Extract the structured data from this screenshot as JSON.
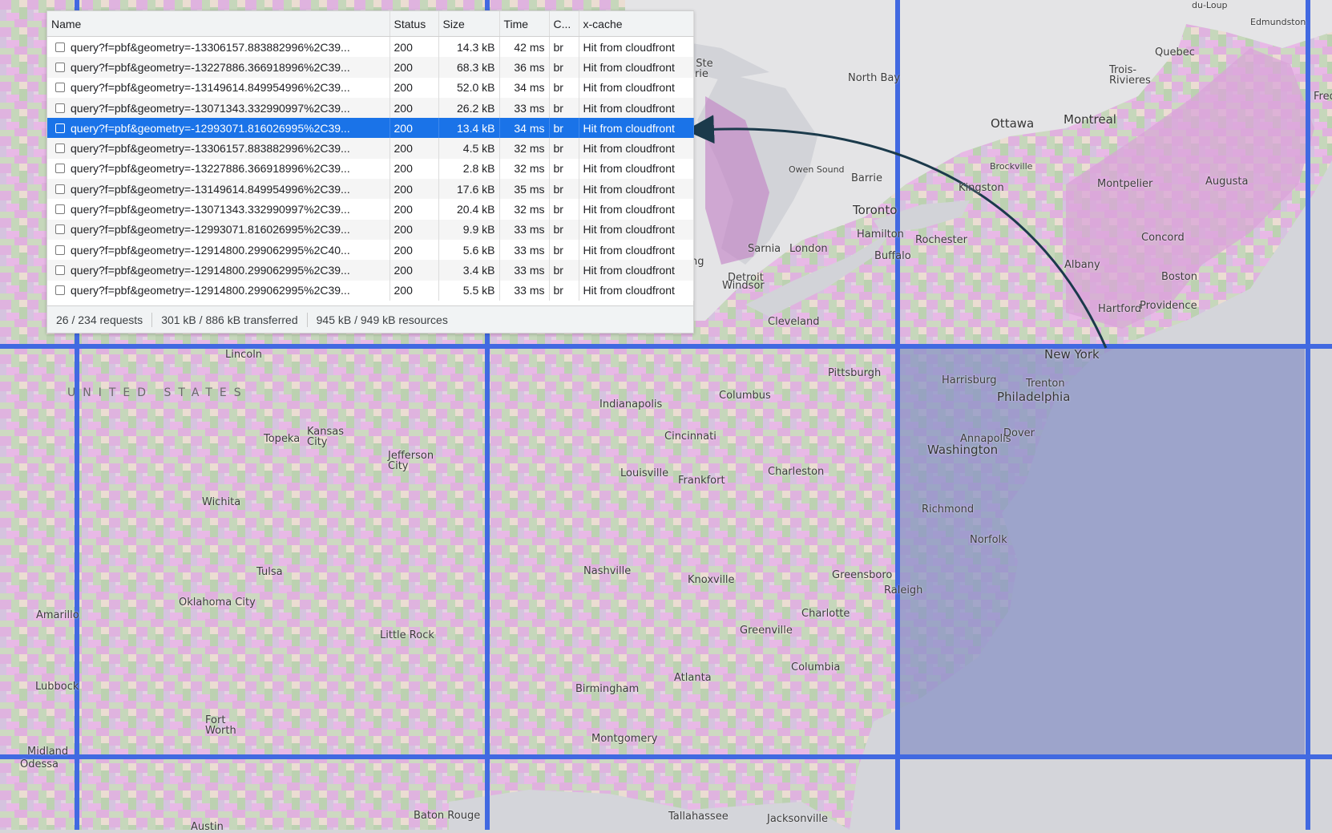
{
  "devtools": {
    "columns": {
      "name": "Name",
      "status": "Status",
      "size": "Size",
      "time": "Time",
      "content_encoding": "C...",
      "xcache": "x-cache"
    },
    "rows": [
      {
        "name": "query?f=pbf&geometry=-13306157.883882996%2C39...",
        "status": "200",
        "size": "14.3 kB",
        "time": "42 ms",
        "encoding": "br",
        "xcache": "Hit from cloudfront"
      },
      {
        "name": "query?f=pbf&geometry=-13227886.366918996%2C39...",
        "status": "200",
        "size": "68.3 kB",
        "time": "36 ms",
        "encoding": "br",
        "xcache": "Hit from cloudfront"
      },
      {
        "name": "query?f=pbf&geometry=-13149614.849954996%2C39...",
        "status": "200",
        "size": "52.0 kB",
        "time": "34 ms",
        "encoding": "br",
        "xcache": "Hit from cloudfront"
      },
      {
        "name": "query?f=pbf&geometry=-13071343.332990997%2C39...",
        "status": "200",
        "size": "26.2 kB",
        "time": "33 ms",
        "encoding": "br",
        "xcache": "Hit from cloudfront"
      },
      {
        "name": "query?f=pbf&geometry=-12993071.816026995%2C39...",
        "status": "200",
        "size": "13.4 kB",
        "time": "34 ms",
        "encoding": "br",
        "xcache": "Hit from cloudfront",
        "selected": true
      },
      {
        "name": "query?f=pbf&geometry=-13306157.883882996%2C39...",
        "status": "200",
        "size": "4.5 kB",
        "time": "32 ms",
        "encoding": "br",
        "xcache": "Hit from cloudfront"
      },
      {
        "name": "query?f=pbf&geometry=-13227886.366918996%2C39...",
        "status": "200",
        "size": "2.8 kB",
        "time": "32 ms",
        "encoding": "br",
        "xcache": "Hit from cloudfront"
      },
      {
        "name": "query?f=pbf&geometry=-13149614.849954996%2C39...",
        "status": "200",
        "size": "17.6 kB",
        "time": "35 ms",
        "encoding": "br",
        "xcache": "Hit from cloudfront"
      },
      {
        "name": "query?f=pbf&geometry=-13071343.332990997%2C39...",
        "status": "200",
        "size": "20.4 kB",
        "time": "32 ms",
        "encoding": "br",
        "xcache": "Hit from cloudfront"
      },
      {
        "name": "query?f=pbf&geometry=-12993071.816026995%2C39...",
        "status": "200",
        "size": "9.9 kB",
        "time": "33 ms",
        "encoding": "br",
        "xcache": "Hit from cloudfront"
      },
      {
        "name": "query?f=pbf&geometry=-12914800.299062995%2C40...",
        "status": "200",
        "size": "5.6 kB",
        "time": "33 ms",
        "encoding": "br",
        "xcache": "Hit from cloudfront"
      },
      {
        "name": "query?f=pbf&geometry=-12914800.299062995%2C39...",
        "status": "200",
        "size": "3.4 kB",
        "time": "33 ms",
        "encoding": "br",
        "xcache": "Hit from cloudfront"
      },
      {
        "name": "query?f=pbf&geometry=-12914800.299062995%2C39...",
        "status": "200",
        "size": "5.5 kB",
        "time": "33 ms",
        "encoding": "br",
        "xcache": "Hit from cloudfront"
      }
    ],
    "status_bar": {
      "requests": "26 / 234 requests",
      "transferred": "301 kB / 886 kB transferred",
      "resources": "945 kB / 949 kB resources"
    }
  },
  "map": {
    "country_label": "UNITED STATES",
    "city_labels": [
      "du-Loup",
      "Edmundston",
      "Quebec",
      "Trois-\nRivieres",
      "Fred",
      "North Bay",
      "t Ste\narie",
      "Ottawa",
      "Montreal",
      "Brockville",
      "Owen Sound",
      "Barrie",
      "Kingston",
      "Montpelier",
      "Augusta",
      "Toronto",
      "Hamilton",
      "Rochester",
      "Concord",
      "Sarnia",
      "London",
      "Buffalo",
      "Albany",
      "Boston",
      "Detroit",
      "Windsor",
      "ng",
      "Hartford",
      "Providence",
      "Cleveland",
      "New York",
      "Lincoln",
      "Pittsburgh",
      "Harrisburg",
      "Trenton",
      "Philadelphia",
      "Indianapolis",
      "Columbus",
      "Topeka",
      "Kansas\nCity",
      "Cincinnati",
      "Annapolis",
      "Dover",
      "Washington",
      "Jefferson\nCity",
      "Louisville",
      "Frankfort",
      "Charleston",
      "Wichita",
      "Richmond",
      "Norfolk",
      "Tulsa",
      "Nashville",
      "Knoxville",
      "Greensboro",
      "Raleigh",
      "Oklahoma City",
      "Charlotte",
      "Amarillo",
      "Little Rock",
      "Greenville",
      "Columbia",
      "Birmingham",
      "Atlanta",
      "Lubbock",
      "Fort\nWorth",
      "Montgomery",
      "Midland",
      "Odessa",
      "Austin",
      "Baton Rouge",
      "Tallahassee",
      "Jacksonville"
    ],
    "colors": {
      "grid_line": "#4169e1",
      "selected_tile": "#8b93c6",
      "pink": "#d89ad6",
      "green": "#a8c49a",
      "water": "#d5d6da",
      "arrow": "#1b3a4b"
    }
  }
}
